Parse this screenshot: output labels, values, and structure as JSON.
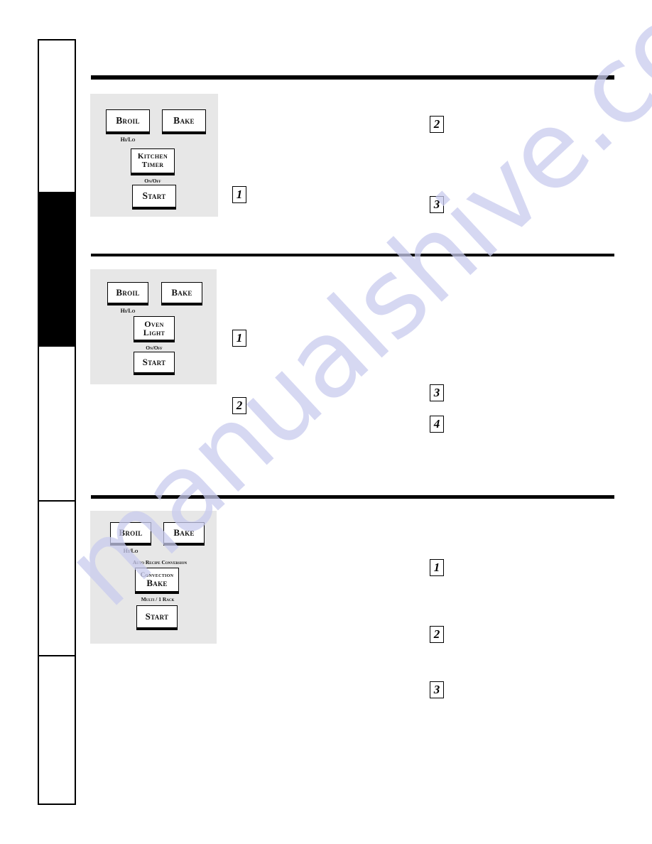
{
  "page": {
    "background_color": "#ffffff",
    "rule_color": "#000000",
    "panel_color": "#e7e7e7",
    "watermark": {
      "text": "manualshive.com",
      "color": "#c9cbee"
    }
  },
  "sidebar": {
    "segments": [
      {
        "name": "tab-segment-1",
        "state": "inactive"
      },
      {
        "name": "tab-segment-2",
        "state": "active"
      },
      {
        "name": "tab-segment-3",
        "state": "inactive"
      },
      {
        "name": "tab-segment-4",
        "state": "inactive"
      },
      {
        "name": "tab-segment-5",
        "state": "inactive"
      }
    ]
  },
  "sections": [
    {
      "id": "section-kitchen-timer",
      "panel": {
        "buttons": [
          {
            "label": "Broil",
            "sublabel": "Hi/Lo"
          },
          {
            "label": "Bake",
            "sublabel": ""
          },
          {
            "label_line1": "Kitchen",
            "label_line2": "Timer",
            "sublabel": "On/Off"
          },
          {
            "label": "Start",
            "sublabel": ""
          }
        ]
      },
      "steps": [
        {
          "number": "1"
        },
        {
          "number": "2"
        },
        {
          "number": "3"
        }
      ]
    },
    {
      "id": "section-oven-light",
      "panel": {
        "buttons": [
          {
            "label": "Broil",
            "sublabel": "Hi/Lo"
          },
          {
            "label": "Bake",
            "sublabel": ""
          },
          {
            "label_line1": "Oven",
            "label_line2": "Light",
            "sublabel": "On/Off"
          },
          {
            "label": "Start",
            "sublabel": ""
          }
        ]
      },
      "steps": [
        {
          "number": "1"
        },
        {
          "number": "2"
        },
        {
          "number": "3"
        },
        {
          "number": "4"
        }
      ]
    },
    {
      "id": "section-convection-bake",
      "panel": {
        "heading": "Auto Recipe Conversion",
        "buttons": [
          {
            "label": "Broil",
            "sublabel": "Hi/Lo"
          },
          {
            "label": "Bake",
            "sublabel": ""
          },
          {
            "label_line1": "Convection",
            "label_line2": "Bake",
            "sublabel": "Multi / 1 Rack"
          },
          {
            "label": "Start",
            "sublabel": ""
          }
        ]
      },
      "steps": [
        {
          "number": "1"
        },
        {
          "number": "2"
        },
        {
          "number": "3"
        }
      ]
    }
  ]
}
